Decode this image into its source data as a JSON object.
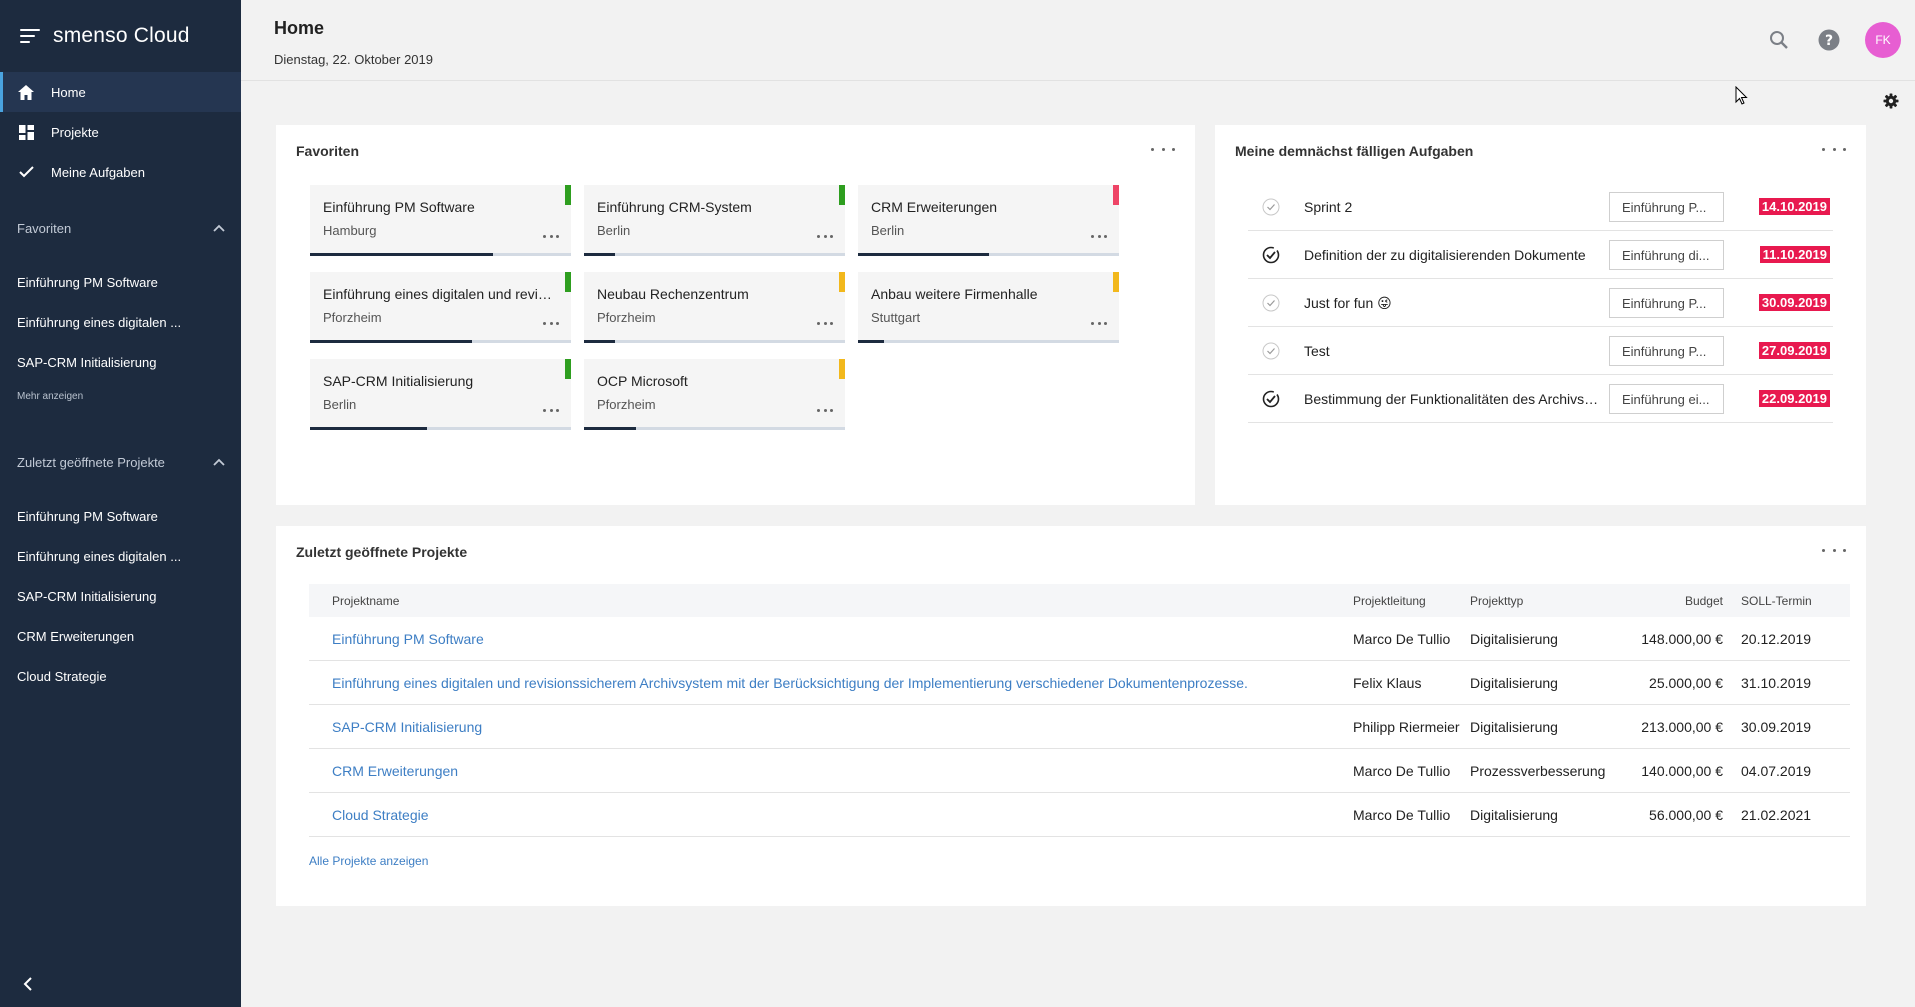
{
  "sidebar": {
    "brand": "smenso Cloud",
    "nav": [
      {
        "label": "Home",
        "icon": "home-icon"
      },
      {
        "label": "Projekte",
        "icon": "dashboard-icon"
      },
      {
        "label": "Meine Aufgaben",
        "icon": "check-icon"
      }
    ],
    "favorites_title": "Favoriten",
    "favorites": [
      "Einführung PM Software",
      "Einführung eines digitalen ...",
      "SAP-CRM Initialisierung"
    ],
    "more_label": "Mehr anzeigen",
    "recent_title": "Zuletzt geöffnete Projekte",
    "recent": [
      "Einführung PM Software",
      "Einführung eines digitalen ...",
      "SAP-CRM Initialisierung",
      "CRM Erweiterungen",
      "Cloud Strategie"
    ]
  },
  "header": {
    "title": "Home",
    "date": "Dienstag, 22. Oktober 2019",
    "avatar_initials": "FK"
  },
  "favorites_card": {
    "title": "Favoriten",
    "tiles": [
      {
        "title": "Einführung PM Software",
        "city": "Hamburg",
        "flag_color": "#2e9e1f",
        "progress": 0.7
      },
      {
        "title": "Einführung CRM-System",
        "city": "Berlin",
        "flag_color": "#2e9e1f",
        "progress": 0.12
      },
      {
        "title": "CRM Erweiterungen",
        "city": "Berlin",
        "flag_color": "#ee4466",
        "progress": 0.5
      },
      {
        "title": "Einführung eines digitalen und revisionssicherem Archivsystem",
        "city": "Pforzheim",
        "flag_color": "#2e9e1f",
        "progress": 0.62
      },
      {
        "title": "Neubau Rechenzentrum",
        "city": "Pforzheim",
        "flag_color": "#f2b81c",
        "progress": 0.12
      },
      {
        "title": "Anbau weitere Firmenhalle",
        "city": "Stuttgart",
        "flag_color": "#f2b81c",
        "progress": 0.1
      },
      {
        "title": "SAP-CRM Initialisierung",
        "city": "Berlin",
        "flag_color": "#2e9e1f",
        "progress": 0.45
      },
      {
        "title": "OCP Microsoft",
        "city": "Pforzheim",
        "flag_color": "#f2b81c",
        "progress": 0.2
      }
    ]
  },
  "tasks_card": {
    "title": "Meine demnächst fälligen Aufgaben",
    "tasks": [
      {
        "name": "Sprint 2",
        "project": "Einführung P...",
        "due": "14.10.2019",
        "done": false
      },
      {
        "name": "Definition der zu digitalisierenden Dokumente",
        "project": "Einführung di...",
        "due": "11.10.2019",
        "done": true
      },
      {
        "name": "Just for fun 😜",
        "project": "Einführung P...",
        "due": "30.09.2019",
        "done": false
      },
      {
        "name": "Test",
        "project": "Einführung P...",
        "due": "27.09.2019",
        "done": false
      },
      {
        "name": "Bestimmung der Funktionalitäten des Archivsystems",
        "project": "Einführung ei...",
        "due": "22.09.2019",
        "done": true
      }
    ]
  },
  "recent_card": {
    "title": "Zuletzt geöffnete Projekte",
    "columns": {
      "name": "Projektname",
      "lead": "Projektleitung",
      "type": "Projekttyp",
      "budget": "Budget",
      "soll": "SOLL-Termin"
    },
    "rows": [
      {
        "name": "Einführung PM Software",
        "lead": "Marco De Tullio",
        "type": "Digitalisierung",
        "budget": "148.000,00 €",
        "soll": "20.12.2019"
      },
      {
        "name": "Einführung eines digitalen und revisionssicherem Archivsystem mit der Berücksichtigung der Implementierung verschiedener Dokumentenprozesse.",
        "lead": "Felix Klaus",
        "type": "Digitalisierung",
        "budget": "25.000,00 €",
        "soll": "31.10.2019"
      },
      {
        "name": "SAP-CRM Initialisierung",
        "lead": "Philipp Riermeier",
        "type": "Digitalisierung",
        "budget": "213.000,00 €",
        "soll": "30.09.2019"
      },
      {
        "name": "CRM Erweiterungen",
        "lead": "Marco De Tullio",
        "type": "Prozessverbesserung",
        "budget": "140.000,00 €",
        "soll": "04.07.2019"
      },
      {
        "name": "Cloud Strategie",
        "lead": "Marco De Tullio",
        "type": "Digitalisierung",
        "budget": "56.000,00 €",
        "soll": "21.02.2021"
      }
    ],
    "all_link": "Alle Projekte anzeigen"
  },
  "colors": {
    "sidebar": "#1d2b3f",
    "accent": "#4aa3df",
    "link": "#3d7ec4",
    "due": "#e8194f",
    "avatar": "#e75ed2"
  }
}
